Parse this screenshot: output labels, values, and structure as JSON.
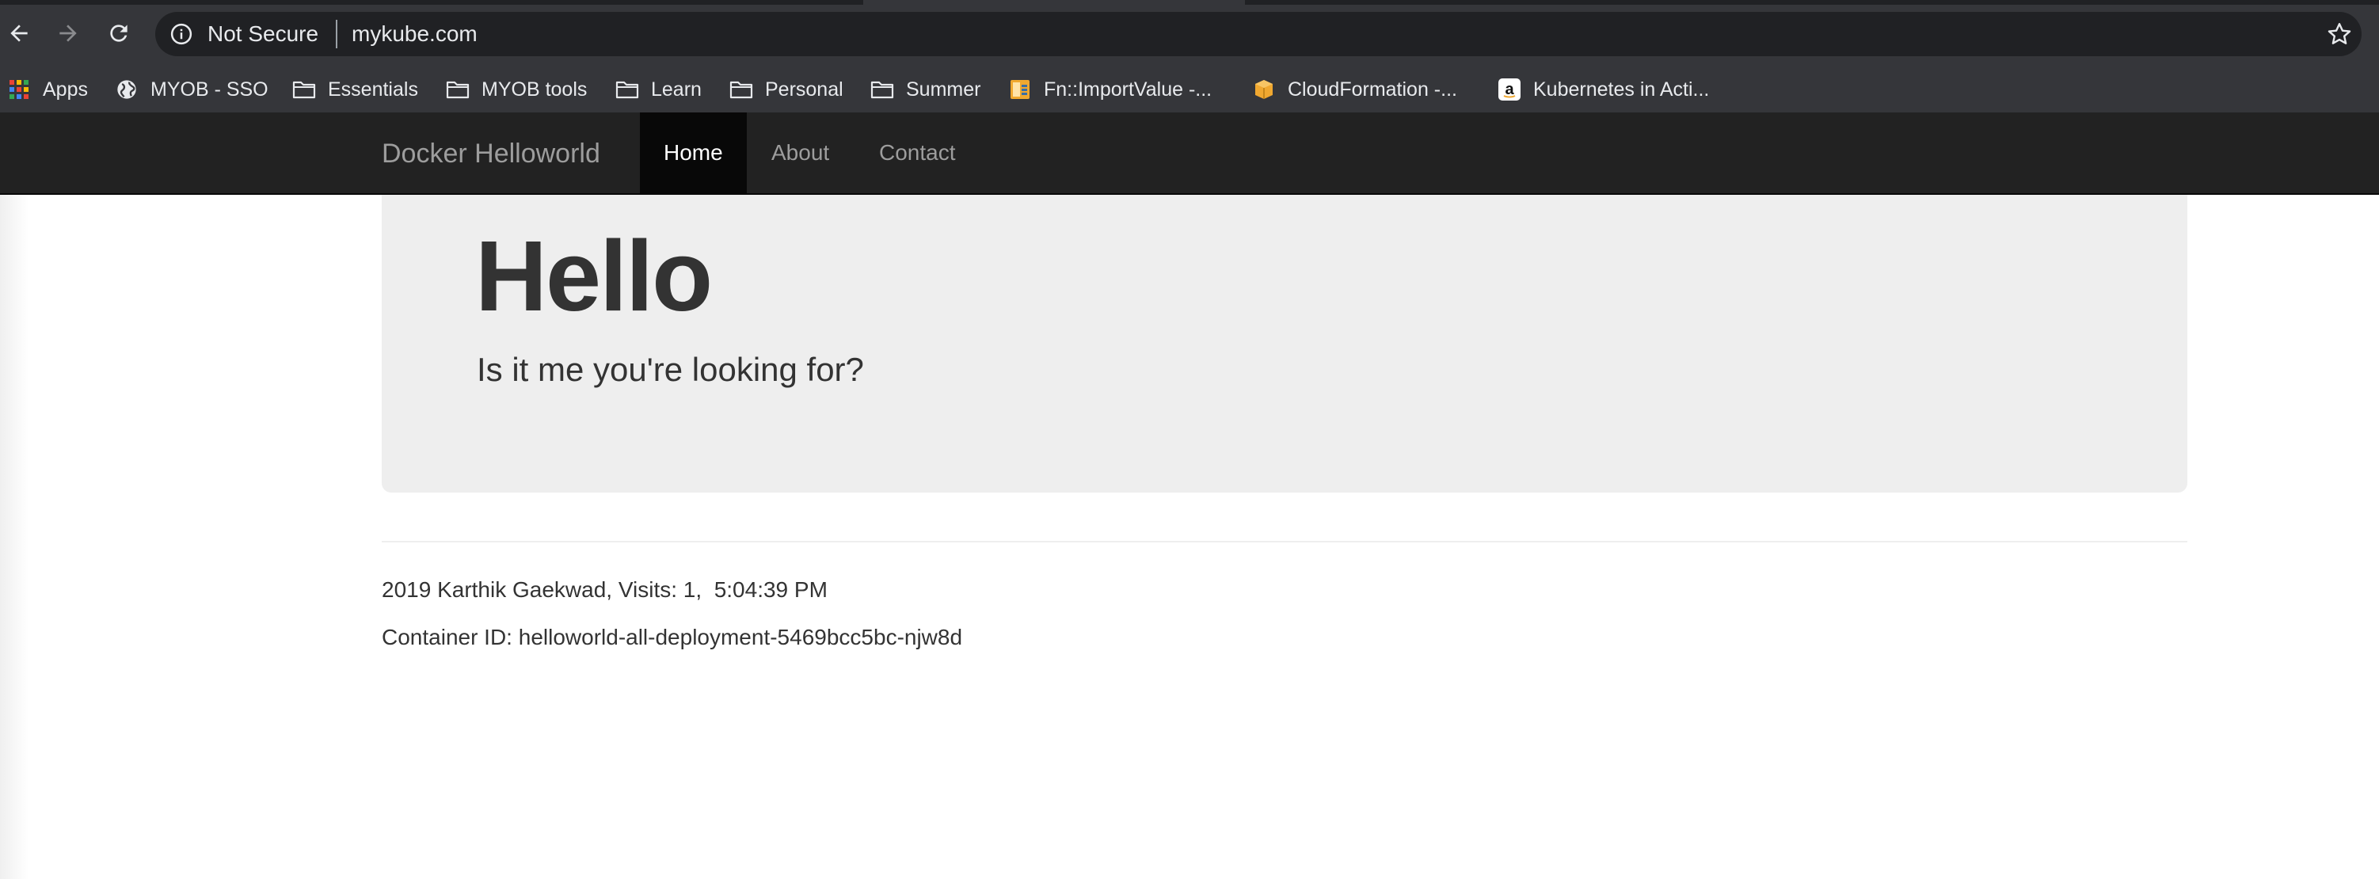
{
  "browser": {
    "security_label": "Not Secure",
    "url": "mykube.com",
    "bookmarks": [
      {
        "label": "Apps",
        "icon": "apps-grid-icon"
      },
      {
        "label": "MYOB - SSO",
        "icon": "globe-icon"
      },
      {
        "label": "Essentials",
        "icon": "folder-icon"
      },
      {
        "label": "MYOB tools",
        "icon": "folder-icon"
      },
      {
        "label": "Learn",
        "icon": "folder-icon"
      },
      {
        "label": "Personal",
        "icon": "folder-icon"
      },
      {
        "label": "Summer",
        "icon": "folder-icon"
      },
      {
        "label": "Fn::ImportValue -...",
        "icon": "aws-docs-icon"
      },
      {
        "label": "CloudFormation -...",
        "icon": "aws-box-icon"
      },
      {
        "label": "Kubernetes in Acti...",
        "icon": "amazon-icon"
      }
    ]
  },
  "navbar": {
    "brand": "Docker Helloworld",
    "links": [
      {
        "label": "Home",
        "active": true
      },
      {
        "label": "About",
        "active": false
      },
      {
        "label": "Contact",
        "active": false
      }
    ]
  },
  "jumbotron": {
    "heading": "Hello",
    "lead": "Is it me you're looking for?"
  },
  "footer": {
    "visits_line": "2019 Karthik Gaekwad, Visits: 1,  5:04:39 PM",
    "container_line": "Container ID: helloworld-all-deployment-5469bcc5bc-njw8d"
  },
  "colors": {
    "chrome_bg": "#35363a",
    "omnibox_bg": "#202124",
    "navbar_bg": "#222222",
    "navbar_active_bg": "#080808",
    "jumbotron_bg": "#eeeeee",
    "text": "#333333"
  }
}
